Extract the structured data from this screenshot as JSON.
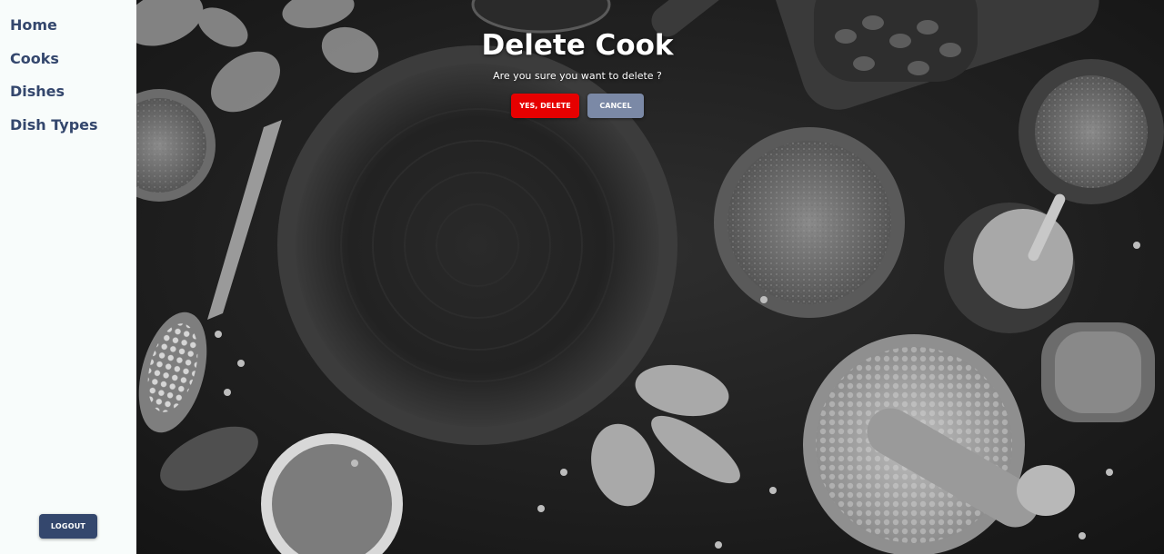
{
  "sidebar": {
    "items": [
      {
        "label": "Home"
      },
      {
        "label": "Cooks"
      },
      {
        "label": "Dishes"
      },
      {
        "label": "Dish Types"
      }
    ],
    "logout_label": "LOGOUT"
  },
  "dialog": {
    "title": "Delete Cook",
    "message": "Are you sure you want to delete ?",
    "confirm_label": "YES, DELETE",
    "cancel_label": "CANCEL"
  },
  "colors": {
    "sidebar_bg": "#f8fcfb",
    "nav_text": "#34476d",
    "logout_bg": "#34476d",
    "danger": "#e60000",
    "cancel": "#7b89a6"
  },
  "background": {
    "description_icon": "food-photo-background"
  }
}
